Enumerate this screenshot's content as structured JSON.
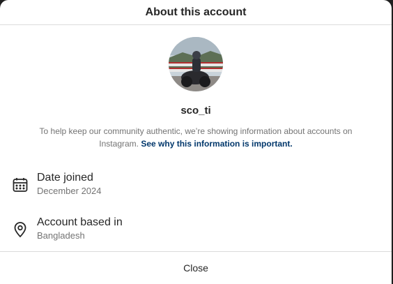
{
  "header": {
    "title": "About this account"
  },
  "profile": {
    "username": "sco_ti"
  },
  "info": {
    "text": "To help keep our community authentic, we’re showing information about accounts on Instagram.",
    "link": "See why this information is important."
  },
  "details": [
    {
      "title": "Date joined",
      "value": "December 2024",
      "icon": "calendar-icon"
    },
    {
      "title": "Account based in",
      "value": "Bangladesh",
      "icon": "location-pin-icon"
    }
  ],
  "footer": {
    "close_label": "Close"
  }
}
